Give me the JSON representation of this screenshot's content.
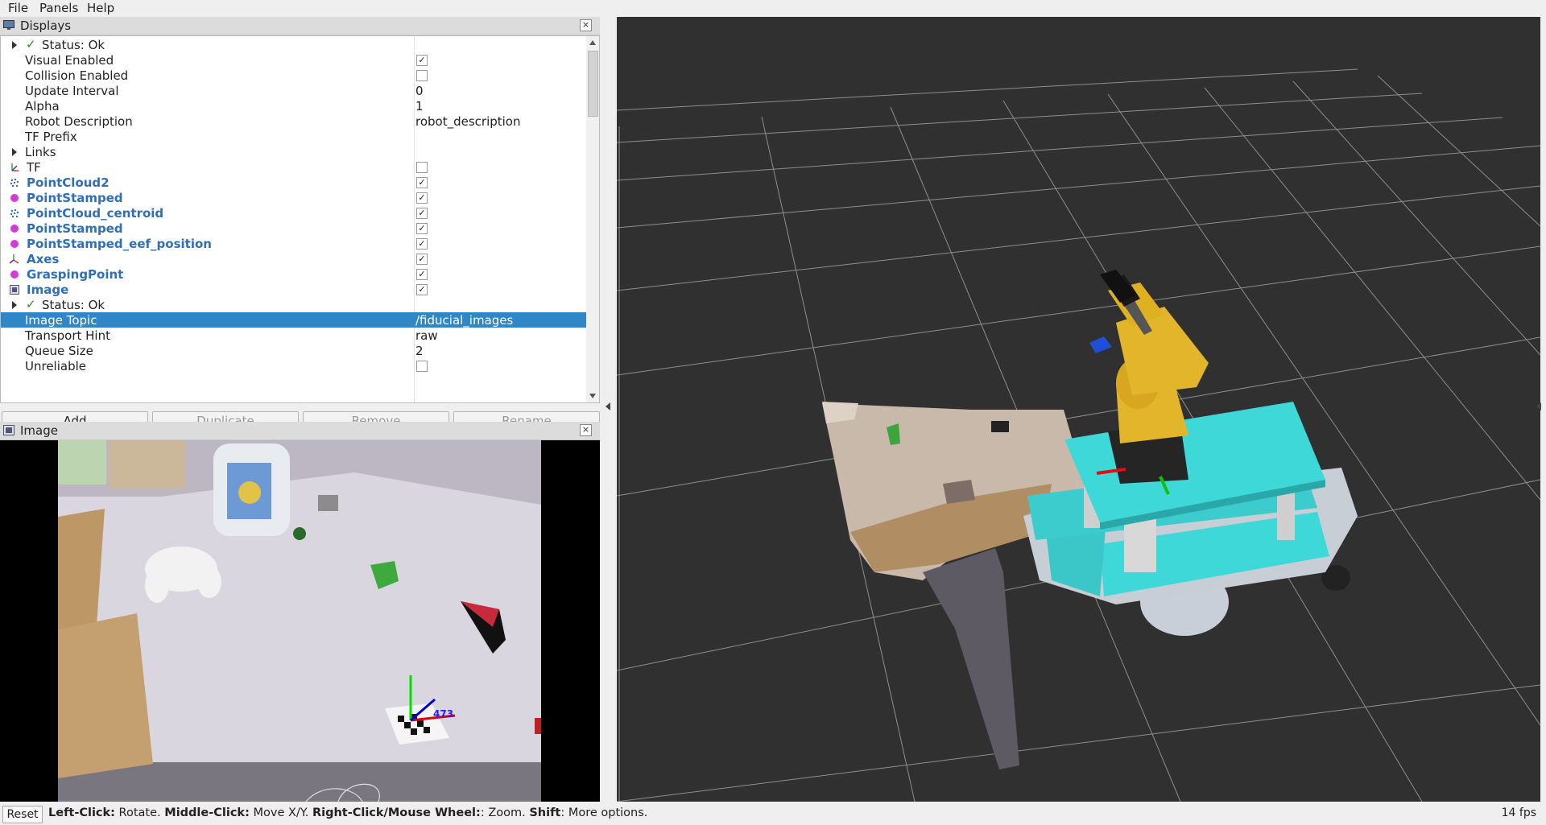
{
  "menu": {
    "file": "File",
    "panels": "Panels",
    "help": "Help"
  },
  "displays": {
    "title": "Displays",
    "rows": [
      {
        "label": "Status: Ok",
        "value": ""
      },
      {
        "label": "Visual Enabled",
        "value": ""
      },
      {
        "label": "Collision Enabled",
        "value": ""
      },
      {
        "label": "Update Interval",
        "value": "0"
      },
      {
        "label": "Alpha",
        "value": "1"
      },
      {
        "label": "Robot Description",
        "value": "robot_description"
      },
      {
        "label": "TF Prefix",
        "value": ""
      },
      {
        "label": "Links",
        "value": ""
      },
      {
        "label": "TF",
        "value": ""
      },
      {
        "label": "PointCloud2",
        "value": ""
      },
      {
        "label": "PointStamped",
        "value": ""
      },
      {
        "label": "PointCloud_centroid",
        "value": ""
      },
      {
        "label": "PointStamped",
        "value": ""
      },
      {
        "label": "PointStamped_eef_position",
        "value": ""
      },
      {
        "label": "Axes",
        "value": ""
      },
      {
        "label": "GraspingPoint",
        "value": ""
      },
      {
        "label": "Image",
        "value": ""
      },
      {
        "label": "Status: Ok",
        "value": ""
      },
      {
        "label": "Image Topic",
        "value": "/fiducial_images"
      },
      {
        "label": "Transport Hint",
        "value": "raw"
      },
      {
        "label": "Queue Size",
        "value": "2"
      },
      {
        "label": "Unreliable",
        "value": ""
      }
    ],
    "checked": {
      "visual_enabled": true,
      "collision_enabled": false,
      "tf": false,
      "pointcloud2": true,
      "pointstamped": true,
      "pointcloud_centroid": true,
      "pointstamped2": true,
      "pointstamped_eef": true,
      "axes": true,
      "graspingpoint": true,
      "image": true,
      "unreliable": false
    },
    "selected_row": "Image Topic"
  },
  "buttons": {
    "add": "Add",
    "duplicate": "Duplicate",
    "remove": "Remove",
    "rename": "Rename"
  },
  "image_panel": {
    "title": "Image",
    "marker_label": "473"
  },
  "statusbar": {
    "reset": "Reset",
    "hint_left_click": "Left-Click:",
    "hint_rotate": " Rotate. ",
    "hint_middle_click": "Middle-Click:",
    "hint_move": " Move X/Y. ",
    "hint_right_click": "Right-Click/Mouse Wheel:",
    "hint_zoom": ": Zoom. ",
    "hint_shift": "Shift",
    "hint_more": ": More options.",
    "fps": "14 fps"
  },
  "colors": {
    "selection": "#2f87c7",
    "display_name": "#2f6fb5",
    "view_bg": "#303030",
    "robot_base": "#3fd8d8",
    "robot_arm": "#e3b52a"
  }
}
